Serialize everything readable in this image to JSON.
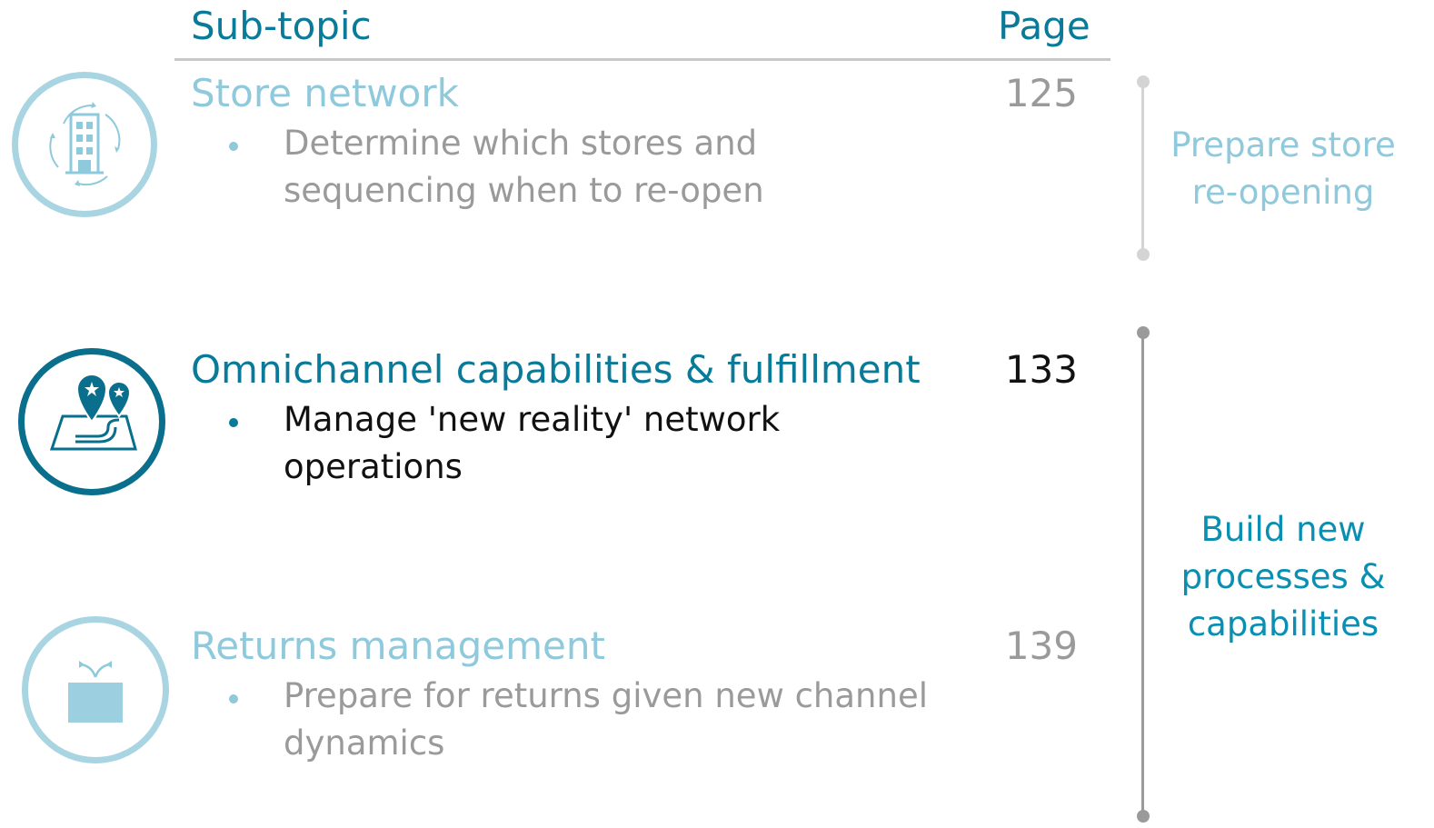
{
  "header": {
    "subtopic_label": "Sub-topic",
    "page_label": "Page"
  },
  "topics": [
    {
      "title": "Store network",
      "page": "125",
      "bullet": "Determine which stores and sequencing when to re-open",
      "icon": "building-cycle-icon",
      "state": "muted"
    },
    {
      "title": "Omnichannel capabilities & fulfillment",
      "page": "133",
      "bullet": "Manage 'new reality' network operations",
      "icon": "map-pins-route-icon",
      "state": "active"
    },
    {
      "title": "Returns management",
      "page": "139",
      "bullet": "Prepare for returns given new channel dynamics",
      "icon": "return-box-icon",
      "state": "muted"
    }
  ],
  "phases": [
    {
      "label": "Prepare store re-opening",
      "state": "muted"
    },
    {
      "label": "Build new processes & capabilities",
      "state": "active"
    }
  ],
  "colors": {
    "accent": "#0a7a99",
    "muted_accent": "#8ec9dc",
    "muted_text": "#9a9a9a",
    "rule": "#c8c8c8"
  }
}
